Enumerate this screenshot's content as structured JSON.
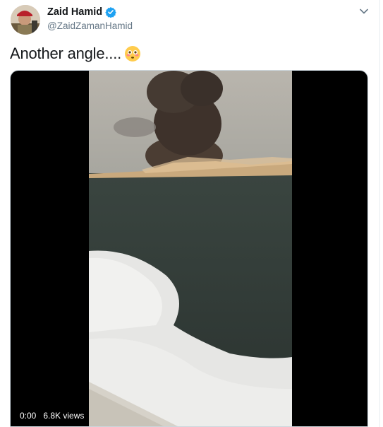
{
  "tweet": {
    "author_name": "Zaid Hamid",
    "author_handle": "@ZaidZamanHamid",
    "verified": true,
    "text": "Another angle....",
    "emoji": "flushed-face-emoji"
  },
  "media": {
    "type": "video",
    "timestamp": "0:00",
    "views": "6.8K views"
  },
  "colors": {
    "text": "#14171a",
    "secondary_text": "#657786",
    "verified_blue": "#1da1f2",
    "border": "#e6ecf0"
  }
}
